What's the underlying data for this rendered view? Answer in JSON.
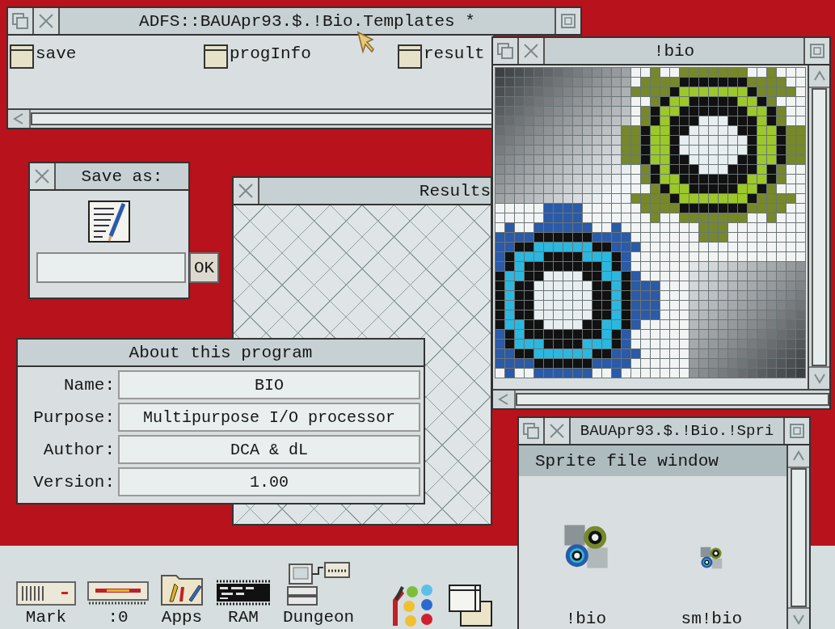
{
  "templates_window": {
    "title": "ADFS::BAUApr93.$.!Bio.Templates *",
    "items": [
      {
        "label": "save"
      },
      {
        "label": "progInfo"
      },
      {
        "label": "result"
      }
    ]
  },
  "sprite_editor": {
    "title": "!bio"
  },
  "save_dialog": {
    "title": "Save as:",
    "button": "OK"
  },
  "results_window": {
    "title": "Results"
  },
  "about_dialog": {
    "title": "About this program",
    "fields": [
      {
        "label": "Name:",
        "value": "BIO"
      },
      {
        "label": "Purpose:",
        "value": "Multipurpose I/O processor"
      },
      {
        "label": "Author:",
        "value": "DCA & dL"
      },
      {
        "label": "Version:",
        "value": "1.00"
      }
    ]
  },
  "sprite_file_window": {
    "title": "BAUApr93.$.!Bio.!Spri",
    "header": "Sprite file window",
    "sprites": [
      {
        "name": "!bio",
        "kind": "large"
      },
      {
        "name": "sm!bio",
        "kind": "small"
      }
    ]
  },
  "icon_bar": {
    "items": [
      {
        "label": "Mark",
        "kind": "drive"
      },
      {
        "label": ":0",
        "kind": "floppy"
      },
      {
        "label": "Apps",
        "kind": "folder"
      },
      {
        "label": "RAM",
        "kind": "chip"
      },
      {
        "label": "Dungeon",
        "kind": "computer"
      },
      {
        "kind": "palette"
      },
      {
        "kind": "windows"
      }
    ]
  }
}
